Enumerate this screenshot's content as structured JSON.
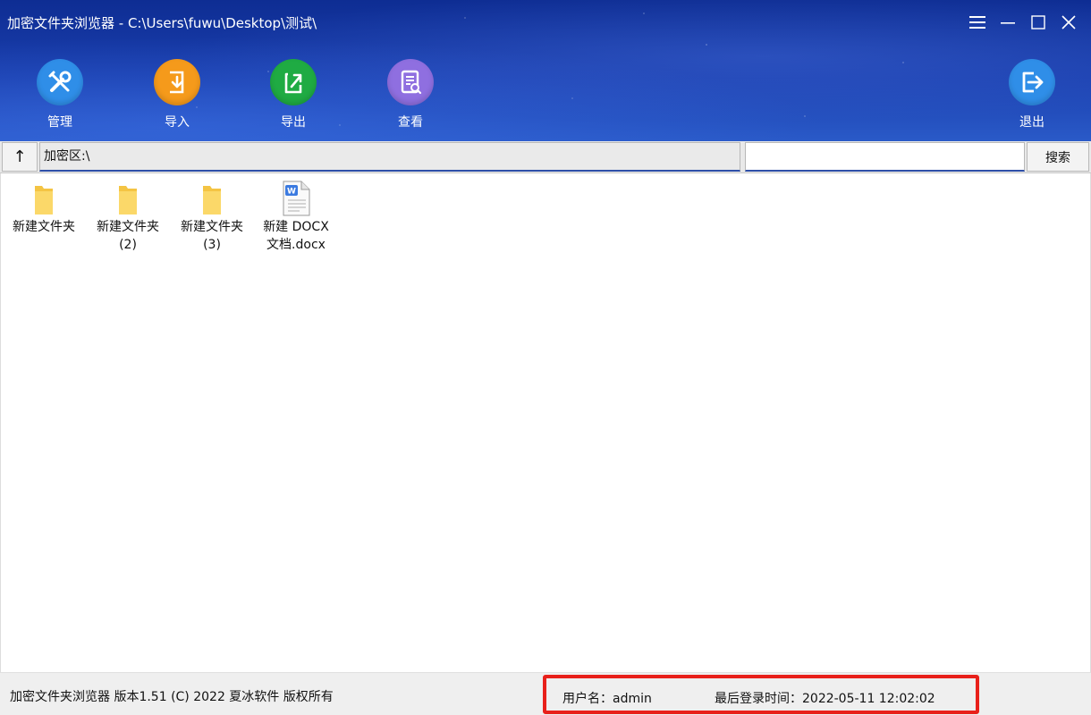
{
  "window": {
    "title": "加密文件夹浏览器  - C:\\Users\\fuwu\\Desktop\\测试\\",
    "controls": [
      "menu-icon",
      "minimize-icon",
      "maximize-icon",
      "close-icon"
    ]
  },
  "toolbar": {
    "manage": {
      "label": "管理",
      "icon": "tools-icon",
      "color": "#2f8ee8"
    },
    "import": {
      "label": "导入",
      "icon": "import-icon",
      "color": "#f59a1b"
    },
    "export": {
      "label": "导出",
      "icon": "export-icon",
      "color": "#1fab43"
    },
    "view": {
      "label": "查看",
      "icon": "view-document-icon",
      "color": "#8f6fe0"
    },
    "logout": {
      "label": "退出",
      "icon": "logout-icon",
      "color": "#2f8ee8"
    }
  },
  "addressbar": {
    "up_label": "↑",
    "path": "加密区:\\",
    "search_placeholder": "",
    "search_value": "",
    "search_button": "搜索"
  },
  "files": [
    {
      "name_line1": "新建文件夹",
      "name_line2": "",
      "type": "folder"
    },
    {
      "name_line1": "新建文件夹",
      "name_line2": "(2)",
      "type": "folder"
    },
    {
      "name_line1": "新建文件夹",
      "name_line2": "(3)",
      "type": "folder"
    },
    {
      "name_line1": "新建 DOCX",
      "name_line2": "文档.docx",
      "type": "docx"
    }
  ],
  "status": {
    "app_info": "加密文件夹浏览器 版本1.51 (C) 2022 夏冰软件 版权所有",
    "user": "用户名：admin",
    "last_login": "最后登录时间：2022-05-11 12:02:02",
    "highlight_color": "#e8201a"
  }
}
